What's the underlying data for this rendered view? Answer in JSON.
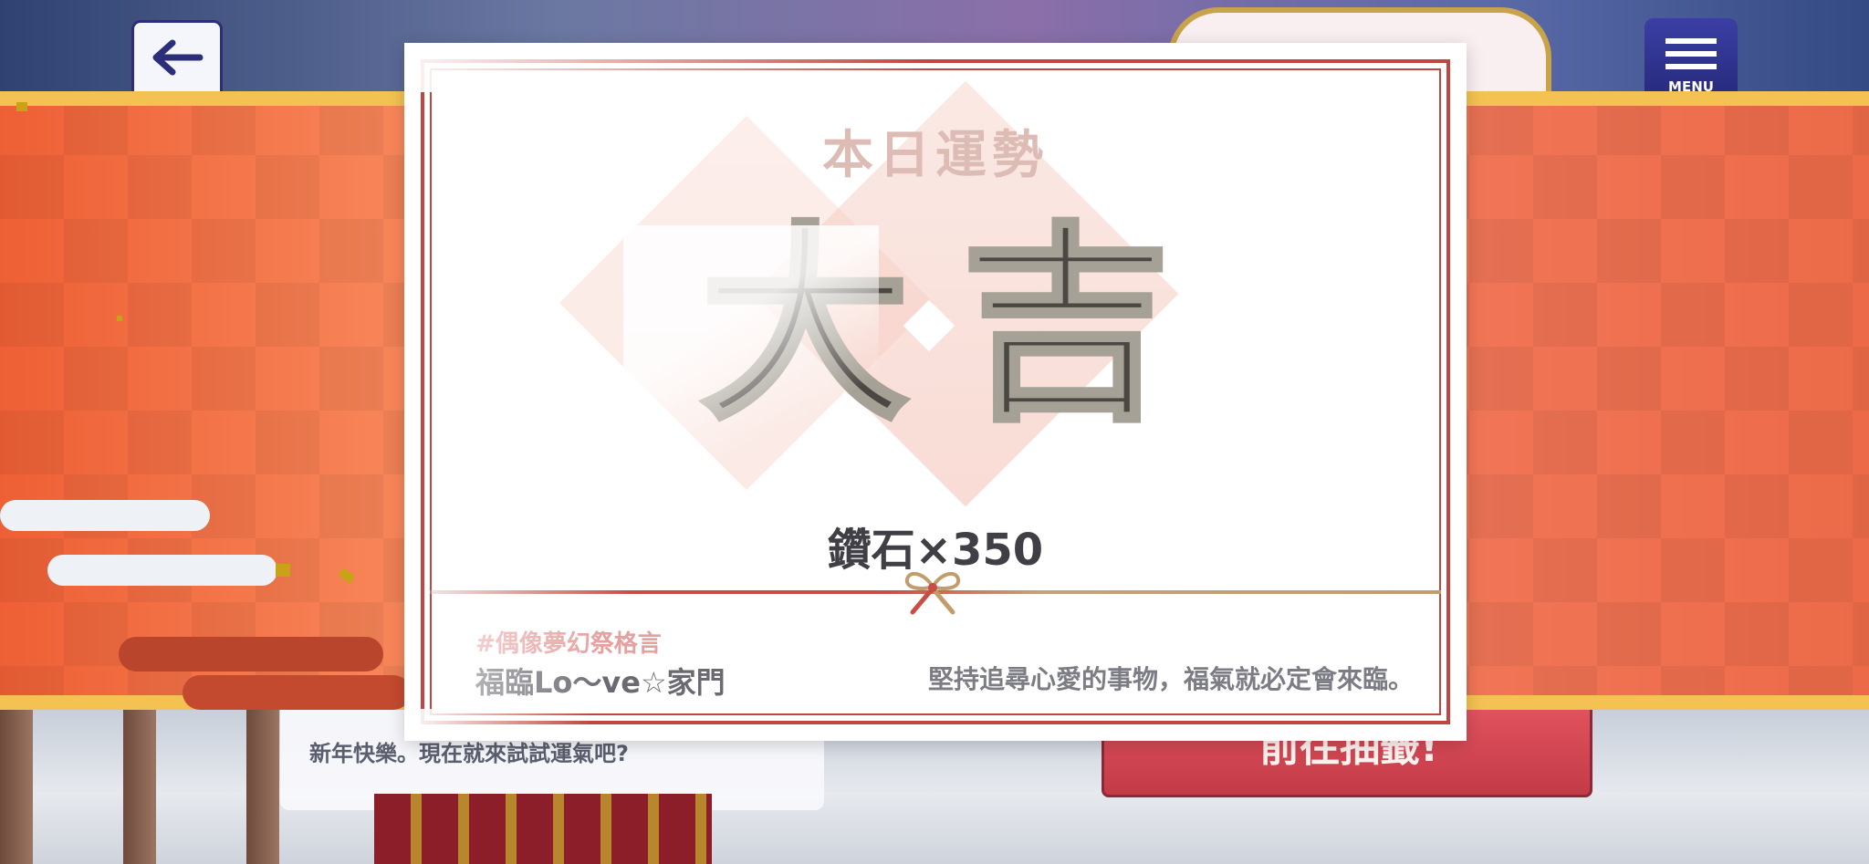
{
  "nav": {
    "menu_label": "MENU"
  },
  "background": {
    "chat_text": "新年快樂。現在就來試試運氣吧?",
    "go_button_label": "前往抽籤!"
  },
  "fortune_card": {
    "title": "本日運勢",
    "result": "大吉",
    "reward": "鑽石×350",
    "quote_tag": "#偶像夢幻祭格言",
    "quote_source": "福臨Lo～ve☆家門",
    "quote_text": "堅持追尋心愛的事物，福氣就必定會來臨。"
  },
  "colors": {
    "banner_orange": "#f07045",
    "banner_gold": "#f3c252",
    "card_border_red": "#c1463f",
    "menu_navy": "#2b2f7a"
  },
  "icons": {
    "back": "left-arrow-icon",
    "menu": "hamburger-menu-icon",
    "ribbon": "ribbon-knot-icon"
  }
}
